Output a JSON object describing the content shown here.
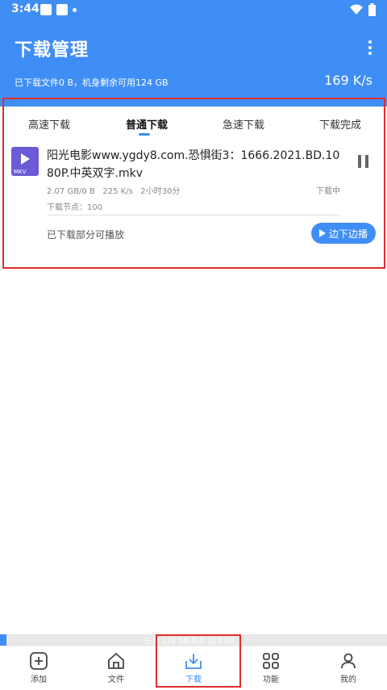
{
  "status_bar": {
    "time": "3:44"
  },
  "header": {
    "title": "下载管理",
    "storage_text": "已下载文件0 B，机身剩余可用124 GB",
    "speed": "169 K/s"
  },
  "tabs": [
    {
      "label": "高速下载"
    },
    {
      "label": "普通下载"
    },
    {
      "label": "急速下载"
    },
    {
      "label": "下载完成"
    }
  ],
  "download_item": {
    "filename": "阳光电影www.ygdy8.com.恐惧街3：1666.2021.BD.1080P.中英双字.mkv",
    "file_ext": "MKV",
    "size_progress": "2.07 GB/0 B",
    "speed": "225 K/s",
    "time_remaining": "2小时30分",
    "status": "下载中",
    "nodes": "下载节点：100",
    "partial_playable": "已下载部分可播放",
    "play_button": "边下边播"
  },
  "bottom_storage": {
    "text": "已用 124 GB 总共 128 GB"
  },
  "nav": [
    {
      "label": "添加",
      "icon": "add-icon"
    },
    {
      "label": "文件",
      "icon": "home-icon"
    },
    {
      "label": "下载",
      "icon": "download-icon"
    },
    {
      "label": "功能",
      "icon": "grid-icon"
    },
    {
      "label": "我的",
      "icon": "user-icon"
    }
  ],
  "colors": {
    "accent": "#3f8ef5",
    "highlight_frame": "#e02d2d"
  }
}
